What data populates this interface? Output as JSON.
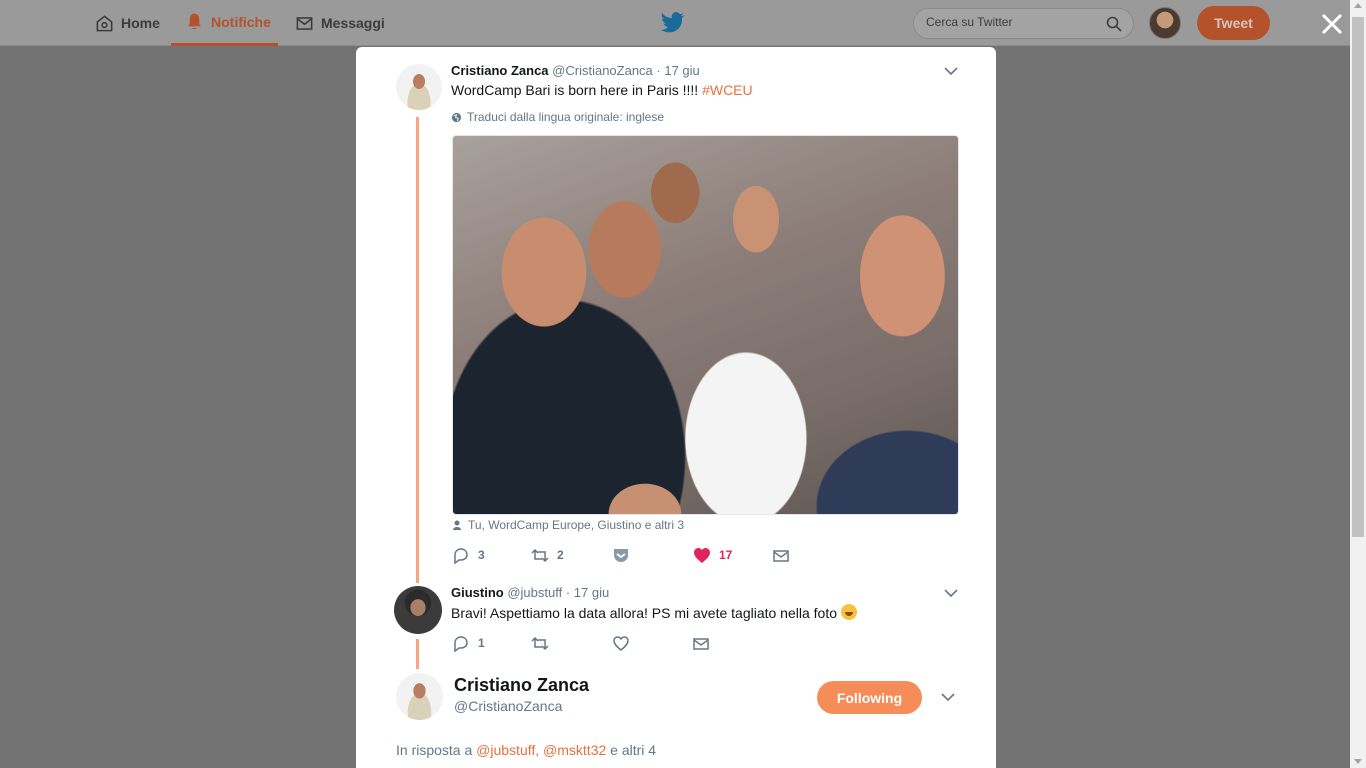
{
  "nav": {
    "home_label": "Home",
    "notifications_label": "Notifiche",
    "messages_label": "Messaggi",
    "search_placeholder": "Cerca su Twitter",
    "tweet_button": "Tweet",
    "logo_icon": "twitter-bird-icon",
    "accent_color": "#b4532b"
  },
  "tweet": {
    "author_name": "Cristiano Zanca",
    "author_handle": "@CristianoZanca",
    "date": "· 17 giu",
    "text": "WordCamp Bari is born here in Paris !!!!",
    "hashtag": "#WCEU",
    "translate_label": "Traduci dalla lingua originale: inglese",
    "tagged_people": "Tu, WordCamp Europe, Giustino e altri 3",
    "reply_count": "3",
    "retweet_count": "2",
    "like_count": "17"
  },
  "reply": {
    "author_name": "Giustino",
    "author_handle": "@jubstuff",
    "date": "· 17 giu",
    "text": "Bravi! Aspettiamo la data allora! PS mi avete tagliato nella foto",
    "reply_count": "1"
  },
  "focus_tweet": {
    "author_name": "Cristiano Zanca",
    "author_handle": "@CristianoZanca",
    "following_button": "Following",
    "reply_to_prefix": "In risposta a",
    "mention_1": "@jubstuff,",
    "mention_2": "@msktt32",
    "reply_to_suffix": "e altri 4"
  },
  "colors": {
    "thread_line": "#f7a582",
    "link": "#e8703f",
    "like": "#e0245e",
    "following_button": "#f68c58"
  }
}
